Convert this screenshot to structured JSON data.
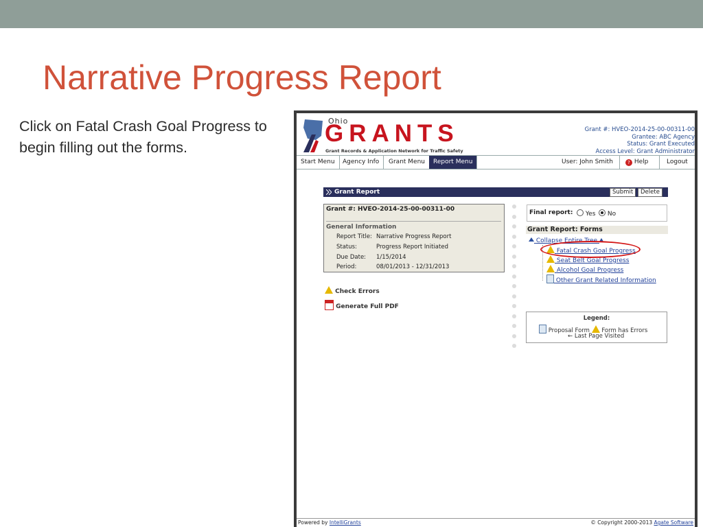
{
  "slide": {
    "title": "Narrative Progress Report",
    "instruction": "Click on Fatal Crash Goal Progress to begin filling out the forms."
  },
  "header": {
    "logo_state": "Ohio",
    "logo_name": "GRANTS",
    "logo_tagline": "Grant Records & Application Network for Traffic Safety",
    "grant_no": "Grant #: HVEO-2014-25-00-00311-00",
    "grantee": "Grantee: ABC Agency",
    "status": "Status: Grant Executed",
    "access": "Access Level: Grant Administrator"
  },
  "menu": {
    "items": [
      "Start Menu",
      "Agency Info",
      "Grant Menu",
      "Report Menu"
    ],
    "user": "User: John Smith",
    "help": "Help",
    "logout": "Logout"
  },
  "report_bar": {
    "title": "Grant Report",
    "submit": "Submit",
    "delete": "Delete"
  },
  "info": {
    "grant_no": "Grant #: HVEO-2014-25-00-00311-00",
    "section": "General Information",
    "rows": [
      {
        "k": "Report Title:",
        "v": "Narrative Progress Report"
      },
      {
        "k": "Status:",
        "v": "Progress Report Initiated"
      },
      {
        "k": "Due Date:",
        "v": "1/15/2014"
      },
      {
        "k": "Period:",
        "v": "08/01/2013 - 12/31/2013"
      }
    ]
  },
  "actions": {
    "check_errors": "Check Errors",
    "generate_pdf": "Generate Full PDF"
  },
  "final_report": {
    "label": "Final report:",
    "yes": "Yes",
    "no": "No"
  },
  "forms": {
    "heading": "Grant Report: Forms",
    "collapse": "Collapse Entire Tree",
    "items": [
      "Fatal Crash Goal Progress",
      "Seat Belt Goal Progress",
      "Alcohol Goal Progress",
      "Other Grant Related Information"
    ]
  },
  "legend": {
    "title": "Legend:",
    "proposal": "Proposal Form",
    "errors": "Form has Errors",
    "last_page": "Last Page Visited"
  },
  "footer": {
    "powered_prefix": "Powered by",
    "powered_link": "IntelliGrants",
    "copyright": "© Copyright 2000-2013",
    "company": "Agate Software"
  },
  "colors": {
    "title": "#d0523a",
    "nav": "#2a2f5c",
    "brand_red": "#c7141e",
    "highlight": "#d41616"
  }
}
